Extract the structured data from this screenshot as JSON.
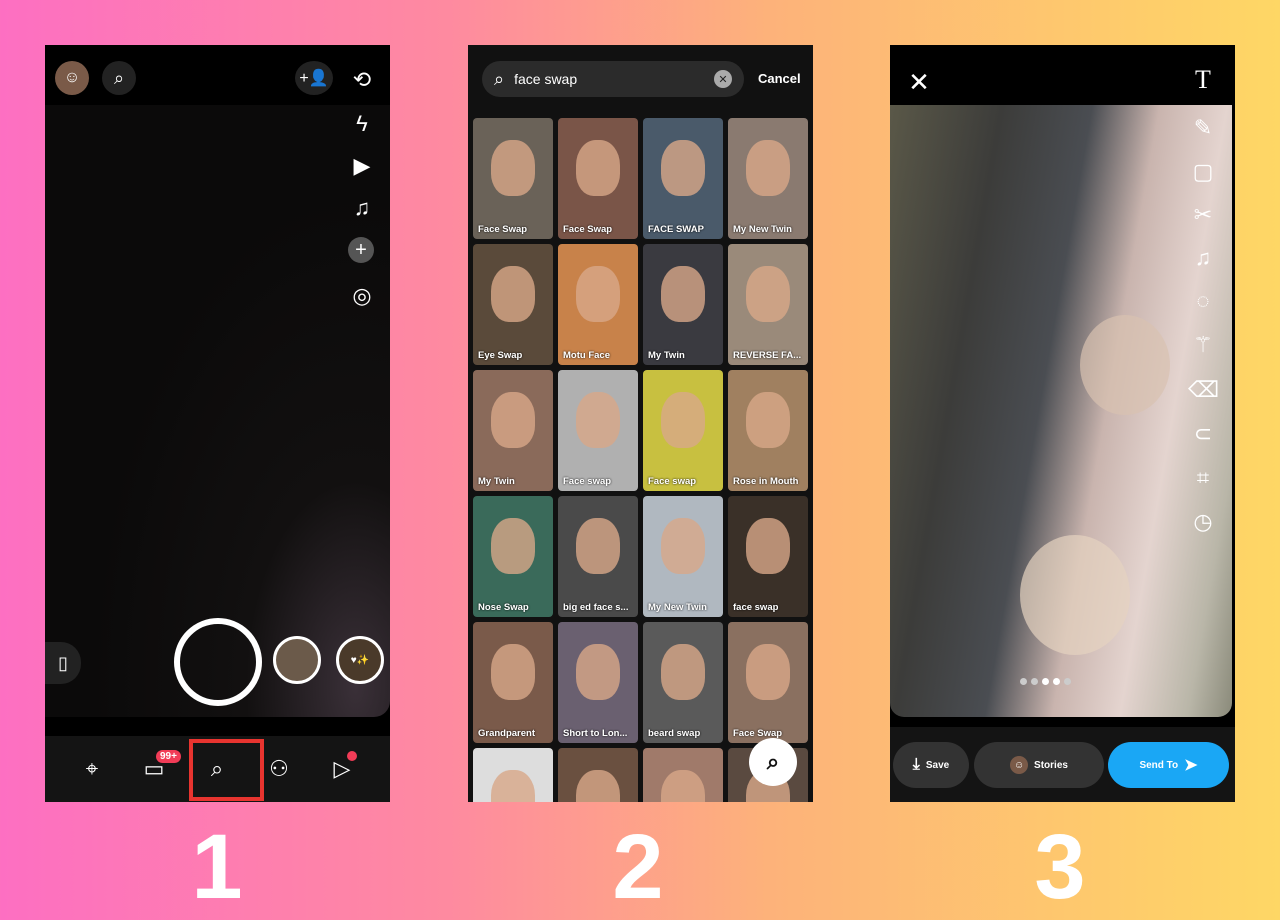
{
  "steps": [
    "1",
    "2",
    "3"
  ],
  "camera": {
    "badge": "99+",
    "nav_icons": [
      "map-pin-icon",
      "chat-icon",
      "spotlight-lens-icon",
      "friends-icon",
      "stories-play-icon"
    ],
    "side_icons": [
      "flip-camera-icon",
      "flash-off-icon",
      "video-icon",
      "music-icon",
      "plus-icon",
      "scan-icon"
    ],
    "highlight_color": "#e8342f"
  },
  "search": {
    "value": "face swap",
    "cancel": "Cancel",
    "lenses": [
      "Face Swap",
      "Face Swap",
      "FACE SWAP",
      "My New Twin",
      "Eye Swap",
      "Motu Face",
      "My Twin",
      "REVERSE FA...",
      "My Twin",
      "Face swap",
      "Face swap",
      "Rose in Mouth",
      "Nose Swap",
      "big ed face s...",
      "My New Twin",
      "face swap",
      "Grandparent",
      "Short to Lon...",
      "beard swap",
      "Face Swap",
      "",
      "",
      "",
      ""
    ]
  },
  "editor": {
    "save": "Save",
    "stories": "Stories",
    "send_to": "Send To",
    "accent": "#1aa7f5",
    "tool_icons": [
      "text-icon",
      "pencil-icon",
      "sticker-icon",
      "scissors-icon",
      "music-icon",
      "lens-icon",
      "magic-wand-icon",
      "eraser-icon",
      "paperclip-icon",
      "crop-icon",
      "timer-icon"
    ]
  }
}
